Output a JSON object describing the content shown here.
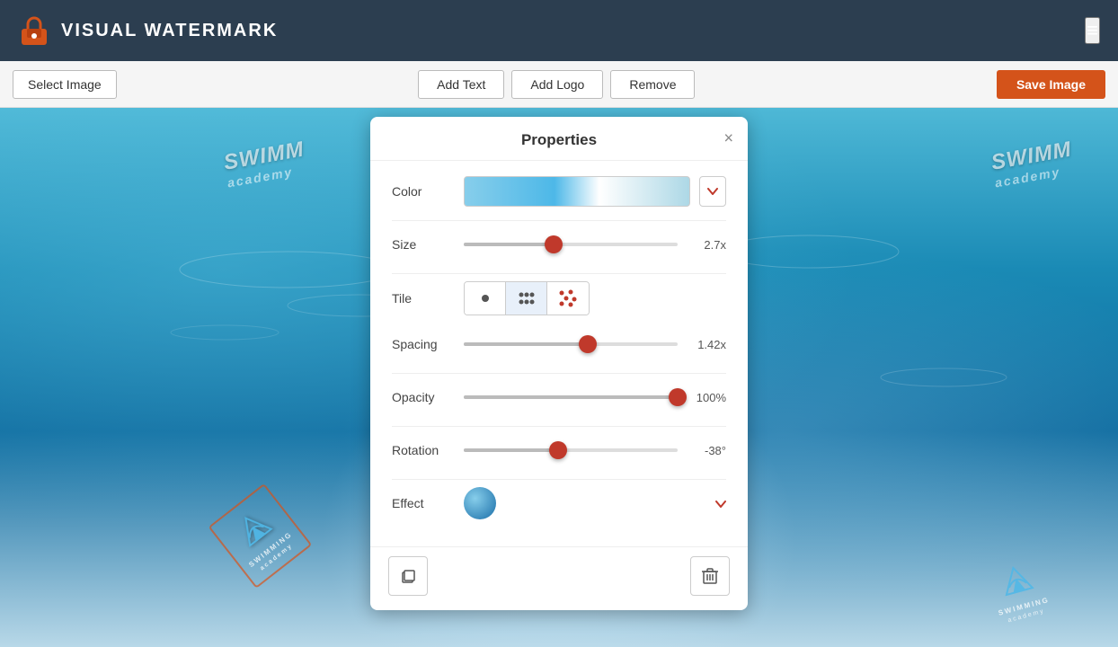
{
  "header": {
    "title": "VISUAL WATERMARK",
    "menu_icon": "≡"
  },
  "toolbar": {
    "select_image_label": "Select Image",
    "add_text_label": "Add Text",
    "add_logo_label": "Add Logo",
    "remove_label": "Remove",
    "save_image_label": "Save Image"
  },
  "properties_panel": {
    "title": "Properties",
    "close_icon": "×",
    "color_label": "Color",
    "size_label": "Size",
    "size_value": "2.7x",
    "size_percent": 42,
    "tile_label": "Tile",
    "spacing_label": "Spacing",
    "spacing_value": "1.42x",
    "spacing_percent": 58,
    "opacity_label": "Opacity",
    "opacity_value": "100%",
    "opacity_percent": 100,
    "rotation_label": "Rotation",
    "rotation_value": "-38°",
    "rotation_percent": 44,
    "effect_label": "Effect",
    "copy_icon": "⧉",
    "delete_icon": "🗑"
  }
}
